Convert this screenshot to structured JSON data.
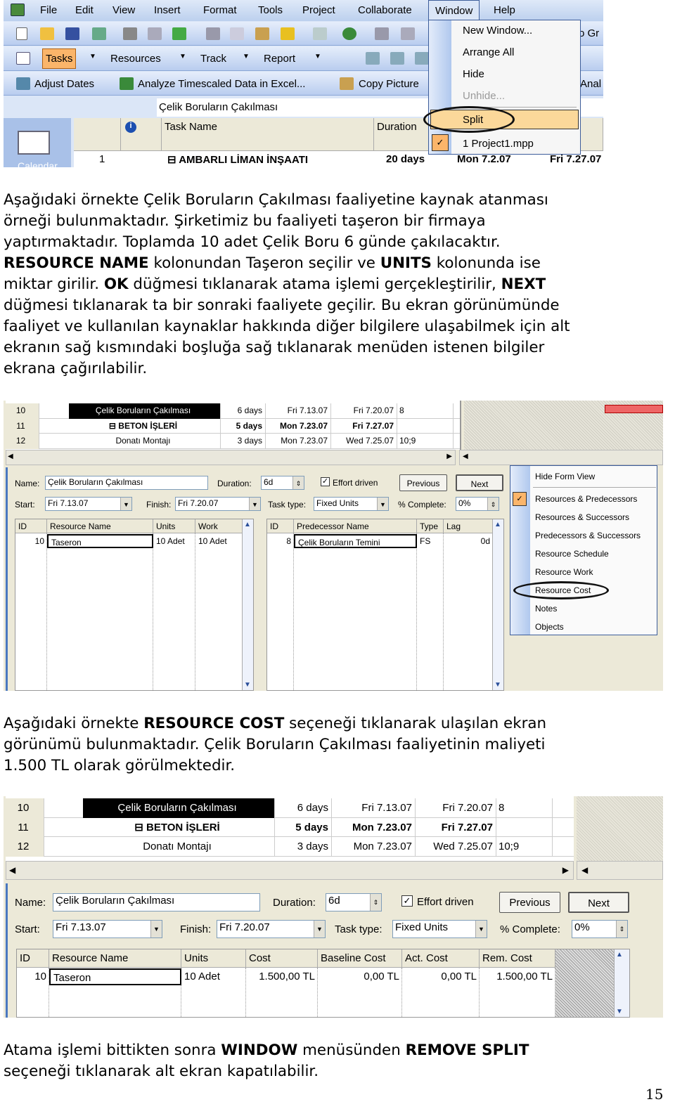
{
  "screenshot1": {
    "menu": [
      "File",
      "Edit",
      "View",
      "Insert",
      "Format",
      "Tools",
      "Project",
      "Collaborate",
      "Window",
      "Help"
    ],
    "view_toolbar": {
      "tasks": "Tasks",
      "resources": "Resources",
      "track": "Track",
      "report": "Report"
    },
    "analysis_toolbar": {
      "adjust_dates": "Adjust Dates",
      "analyze": "Analyze Timescaled Data in Excel...",
      "copy_picture": "Copy Picture",
      "cut_label": "Anal"
    },
    "cut_toolbar_text": "o Gr",
    "entry_value": "Çelik Boruların Çakılması",
    "view_bar_label": "Calendar",
    "grid": {
      "headers": {
        "task_name": "Task Name",
        "duration": "Duration"
      },
      "row": {
        "id": "1",
        "name": "AMBARLI LİMAN İNŞAATI",
        "duration": "20 days",
        "start": "Mon 7.2.07",
        "finish": "Fri 7.27.07"
      }
    },
    "window_menu": {
      "items": [
        {
          "label": "New Window...",
          "state": "normal"
        },
        {
          "label": "Arrange All",
          "state": "normal"
        },
        {
          "label": "Hide",
          "state": "normal"
        },
        {
          "label": "Unhide...",
          "state": "disabled"
        },
        {
          "label": "Split",
          "state": "highlighted-circled"
        },
        {
          "label": "1 Project1.mpp",
          "state": "checked"
        }
      ]
    }
  },
  "paragraphs": [
    {
      "lines": [
        [
          {
            "t": "Aşağıdaki örnekte Çelik Boruların Çakılması faaliyetine kaynak atanması"
          }
        ],
        [
          {
            "t": "örneği bulunmaktadır. Şirketimiz bu faaliyeti taşeron bir firmaya"
          }
        ],
        [
          {
            "t": "yaptırmaktadır. Toplamda 10 adet Çelik Boru 6 günde çakılacaktır."
          }
        ],
        [
          {
            "t": "RESOURCE NAME",
            "b": true
          },
          {
            "t": " kolonundan Taşeron seçilir ve "
          },
          {
            "t": "UNITS",
            "b": true
          },
          {
            "t": " kolonunda ise"
          }
        ],
        [
          {
            "t": "miktar girilir. "
          },
          {
            "t": "OK",
            "b": true
          },
          {
            "t": " düğmesi tıklanarak atama işlemi gerçekleştirilir, "
          },
          {
            "t": "NEXT",
            "b": true
          }
        ],
        [
          {
            "t": "düğmesi tıklanarak ta bir sonraki faaliyete geçilir. Bu ekran görünümünde"
          }
        ],
        [
          {
            "t": "faaliyet ve kullanılan kaynaklar hakkında diğer bilgilere ulaşabilmek için alt"
          }
        ],
        [
          {
            "t": "ekranın sağ kısmındaki boşluğa sağ tıklanarak menüden istenen bilgiler"
          }
        ],
        [
          {
            "t": "ekrana çağırılabilir."
          }
        ]
      ]
    },
    {
      "lines": [
        [
          {
            "t": "Aşağıdaki örnekte "
          },
          {
            "t": "RESOURCE COST",
            "b": true
          },
          {
            "t": " seçeneği tıklanarak ulaşılan ekran"
          }
        ],
        [
          {
            "t": "görünümü bulunmaktadır. Çelik Boruların Çakılması faaliyetinin maliyeti"
          }
        ],
        [
          {
            "t": "1.500 TL olarak görülmektedir."
          }
        ]
      ]
    },
    {
      "lines": [
        [
          {
            "t": "Atama işlemi bittikten sonra "
          },
          {
            "t": "WINDOW",
            "b": true
          },
          {
            "t": " menüsünden "
          },
          {
            "t": "REMOVE SPLIT",
            "b": true
          }
        ],
        [
          {
            "t": "seçeneği tıklanarak alt ekran kapatılabilir."
          }
        ]
      ]
    }
  ],
  "task_rows": [
    {
      "id": "10",
      "name": "Çelik Boruların Çakılması",
      "duration": "6 days",
      "start": "Fri 7.13.07",
      "finish": "Fri 7.20.07",
      "pred": "8",
      "selected": true
    },
    {
      "id": "11",
      "name": "⊟ BETON İŞLERİ",
      "duration": "5 days",
      "start": "Mon 7.23.07",
      "finish": "Fri 7.27.07",
      "pred": "",
      "summary": true
    },
    {
      "id": "12",
      "name": "Donatı Montajı",
      "duration": "3 days",
      "start": "Mon 7.23.07",
      "finish": "Wed 7.25.07",
      "pred": "10;9"
    }
  ],
  "form": {
    "name_label": "Name:",
    "name_value": "Çelik Boruların Çakılması",
    "duration_label": "Duration:",
    "duration_value": "6d",
    "effort_driven_label": "Effort driven",
    "effort_driven_checked": true,
    "previous": "Previous",
    "next": "Next",
    "start_label": "Start:",
    "start_value": "Fri 7.13.07",
    "finish_label": "Finish:",
    "finish_value": "Fri 7.20.07",
    "task_type_label": "Task type:",
    "task_type_value": "Fixed Units",
    "complete_label": "% Complete:",
    "complete_value": "0%"
  },
  "screenshot2": {
    "resources_table": {
      "headers": [
        "ID",
        "Resource Name",
        "Units",
        "Work"
      ],
      "row": [
        "10",
        "Taseron",
        "10 Adet",
        "10 Adet"
      ]
    },
    "predecessors_table": {
      "headers": [
        "ID",
        "Predecessor Name",
        "Type",
        "Lag"
      ],
      "row": [
        "8",
        "Çelik Boruların Temini",
        "FS",
        "0d"
      ]
    },
    "context_menu": {
      "items": [
        {
          "label": "Hide Form View"
        },
        {
          "label": "Resources & Predecessors",
          "checked": true
        },
        {
          "label": "Resources & Successors"
        },
        {
          "label": "Predecessors & Successors"
        },
        {
          "label": "Resource Schedule"
        },
        {
          "label": "Resource Work"
        },
        {
          "label": "Resource Cost",
          "circled": true
        },
        {
          "label": "Notes"
        },
        {
          "label": "Objects"
        }
      ]
    }
  },
  "screenshot3": {
    "cost_table": {
      "headers": [
        "ID",
        "Resource Name",
        "Units",
        "Cost",
        "Baseline Cost",
        "Act. Cost",
        "Rem. Cost"
      ],
      "row": [
        "10",
        "Taseron",
        "10 Adet",
        "1.500,00 TL",
        "0,00 TL",
        "0,00 TL",
        "1.500,00 TL"
      ]
    }
  },
  "page_number": "15",
  "colors": {
    "menu_highlight": "#fbd89a",
    "xp_blue": "#bcd0ee",
    "form_bg": "#ece9d8",
    "selected_row": "#000000"
  }
}
